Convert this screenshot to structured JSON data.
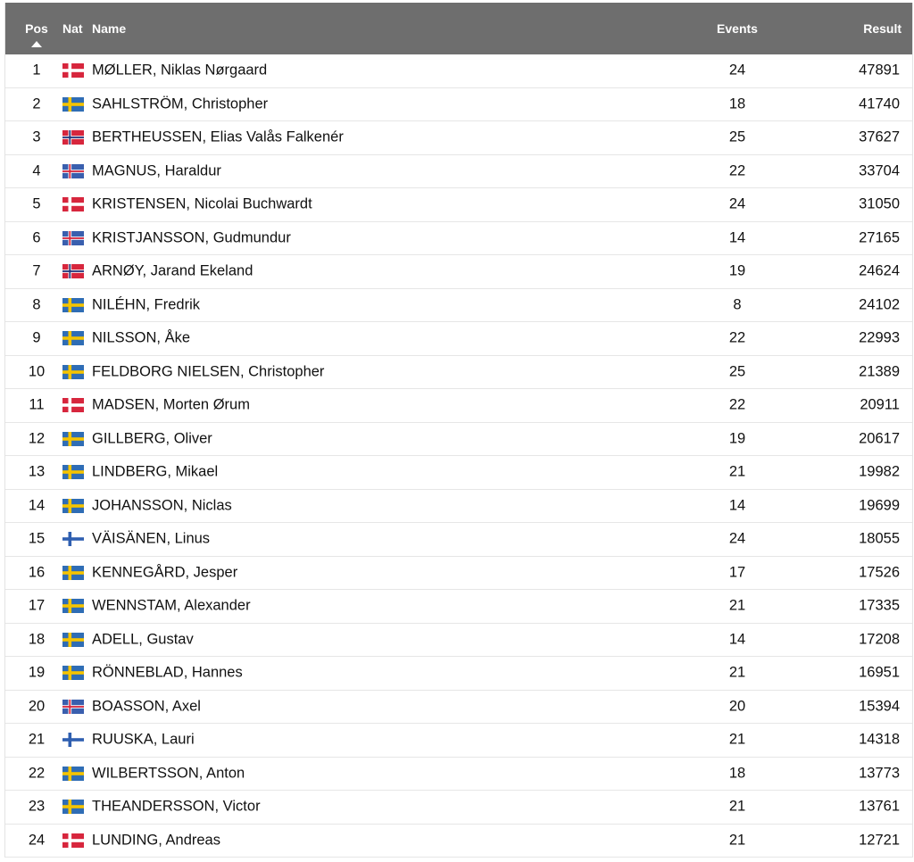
{
  "header": {
    "pos": "Pos",
    "nat": "Nat",
    "name": "Name",
    "events": "Events",
    "result": "Result",
    "sort_icon": "sort-ascending-icon"
  },
  "flag_colors": {
    "DEN": {
      "field": "#d7263d",
      "cross": "#ffffff",
      "inner": ""
    },
    "SWE": {
      "field": "#2f6db5",
      "cross": "#f5c400",
      "inner": ""
    },
    "NOR": {
      "field": "#d7263d",
      "cross": "#ffffff",
      "inner": "#23357a"
    },
    "ISL": {
      "field": "#3a5fae",
      "cross": "#ffffff",
      "inner": "#d7263d"
    },
    "FIN": {
      "field": "#ffffff",
      "cross": "#2f5fb0",
      "inner": ""
    }
  },
  "rows": [
    {
      "pos": "1",
      "nat": "DEN",
      "name": "MØLLER, Niklas Nørgaard",
      "events": "24",
      "result": "47891"
    },
    {
      "pos": "2",
      "nat": "SWE",
      "name": "SAHLSTRÖM, Christopher",
      "events": "18",
      "result": "41740"
    },
    {
      "pos": "3",
      "nat": "NOR",
      "name": "BERTHEUSSEN, Elias Valås Falkenér",
      "events": "25",
      "result": "37627"
    },
    {
      "pos": "4",
      "nat": "ISL",
      "name": "MAGNUS, Haraldur",
      "events": "22",
      "result": "33704"
    },
    {
      "pos": "5",
      "nat": "DEN",
      "name": "KRISTENSEN, Nicolai Buchwardt",
      "events": "24",
      "result": "31050"
    },
    {
      "pos": "6",
      "nat": "ISL",
      "name": "KRISTJANSSON, Gudmundur",
      "events": "14",
      "result": "27165"
    },
    {
      "pos": "7",
      "nat": "NOR",
      "name": "ARNØY, Jarand Ekeland",
      "events": "19",
      "result": "24624"
    },
    {
      "pos": "8",
      "nat": "SWE",
      "name": "NILÉHN, Fredrik",
      "events": "8",
      "result": "24102"
    },
    {
      "pos": "9",
      "nat": "SWE",
      "name": "NILSSON, Åke",
      "events": "22",
      "result": "22993"
    },
    {
      "pos": "10",
      "nat": "SWE",
      "name": "FELDBORG NIELSEN, Christopher",
      "events": "25",
      "result": "21389"
    },
    {
      "pos": "11",
      "nat": "DEN",
      "name": "MADSEN, Morten Ørum",
      "events": "22",
      "result": "20911"
    },
    {
      "pos": "12",
      "nat": "SWE",
      "name": "GILLBERG, Oliver",
      "events": "19",
      "result": "20617"
    },
    {
      "pos": "13",
      "nat": "SWE",
      "name": "LINDBERG, Mikael",
      "events": "21",
      "result": "19982"
    },
    {
      "pos": "14",
      "nat": "SWE",
      "name": "JOHANSSON, Niclas",
      "events": "14",
      "result": "19699"
    },
    {
      "pos": "15",
      "nat": "FIN",
      "name": "VÄISÄNEN, Linus",
      "events": "24",
      "result": "18055"
    },
    {
      "pos": "16",
      "nat": "SWE",
      "name": "KENNEGÅRD, Jesper",
      "events": "17",
      "result": "17526"
    },
    {
      "pos": "17",
      "nat": "SWE",
      "name": "WENNSTAM, Alexander",
      "events": "21",
      "result": "17335"
    },
    {
      "pos": "18",
      "nat": "SWE",
      "name": "ADELL, Gustav",
      "events": "14",
      "result": "17208"
    },
    {
      "pos": "19",
      "nat": "SWE",
      "name": "RÖNNEBLAD, Hannes",
      "events": "21",
      "result": "16951"
    },
    {
      "pos": "20",
      "nat": "ISL",
      "name": "BOASSON, Axel",
      "events": "20",
      "result": "15394"
    },
    {
      "pos": "21",
      "nat": "FIN",
      "name": "RUUSKA, Lauri",
      "events": "21",
      "result": "14318"
    },
    {
      "pos": "22",
      "nat": "SWE",
      "name": "WILBERTSSON, Anton",
      "events": "18",
      "result": "13773"
    },
    {
      "pos": "23",
      "nat": "SWE",
      "name": "THEANDERSSON, Victor",
      "events": "21",
      "result": "13761"
    },
    {
      "pos": "24",
      "nat": "DEN",
      "name": "LUNDING, Andreas",
      "events": "21",
      "result": "12721"
    }
  ]
}
